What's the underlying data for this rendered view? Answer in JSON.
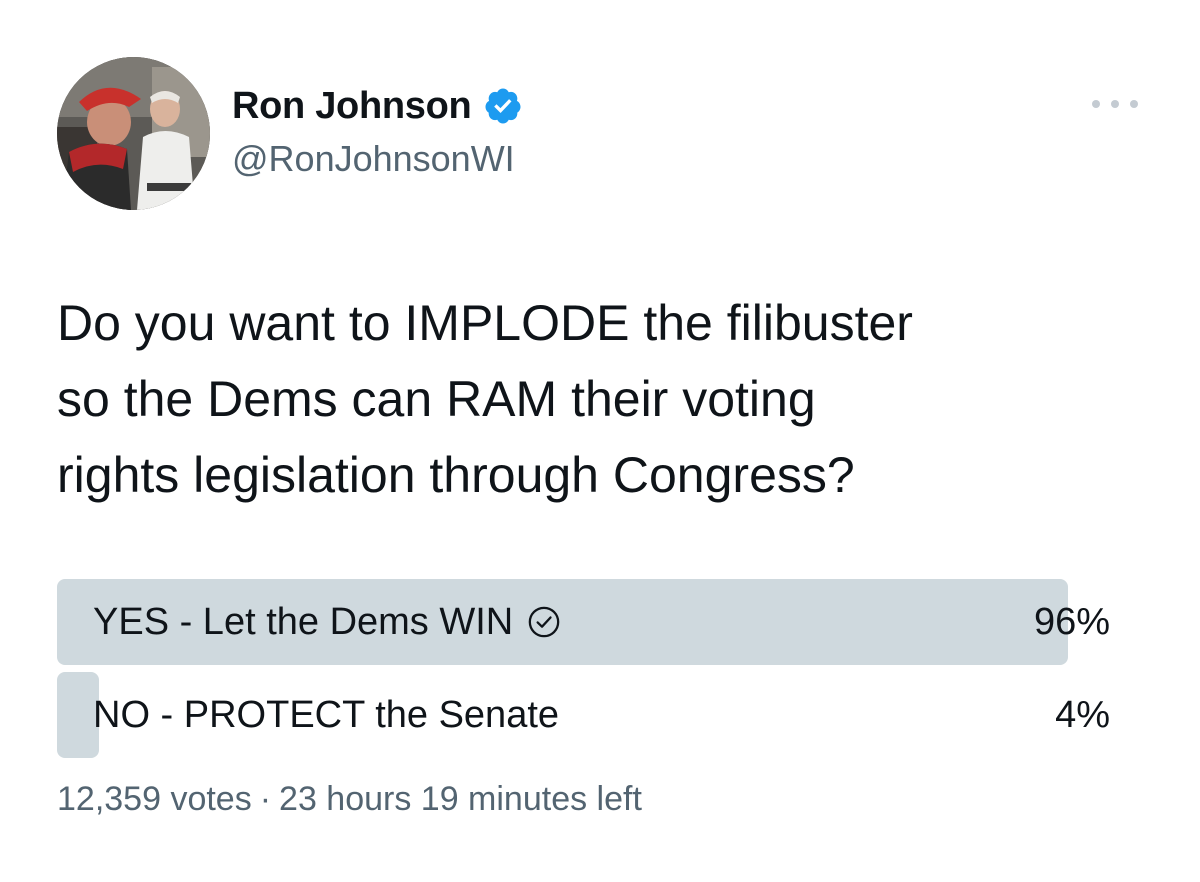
{
  "author": {
    "display_name": "Ron Johnson",
    "handle": "@RonJohnsonWI",
    "verified": true,
    "avatar_icon": "profile-photo"
  },
  "tweet": {
    "text": "Do you want to IMPLODE the filibuster\nso the Dems can RAM their voting\nrights legislation through Congress?"
  },
  "poll": {
    "options": [
      {
        "label": "YES - Let the Dems WIN",
        "percent_label": "96%",
        "percent": 96,
        "winner": true
      },
      {
        "label": "NO - PROTECT the Senate",
        "percent_label": "4%",
        "percent": 4,
        "winner": false
      }
    ],
    "votes": "12,359 votes",
    "separator": "·",
    "time_left": "23 hours 19 minutes left"
  },
  "colors": {
    "verified_badge": "#1d9bf0",
    "bar": "#cfd9de",
    "secondary_text": "#536471"
  }
}
